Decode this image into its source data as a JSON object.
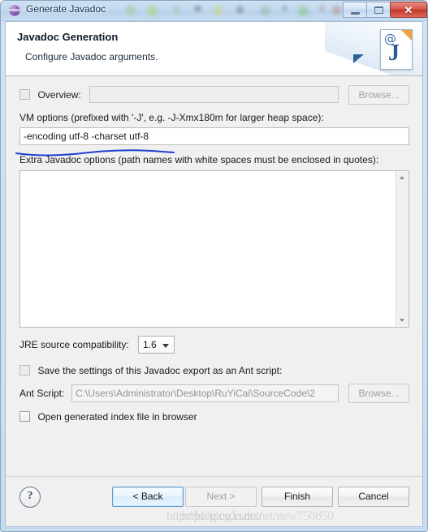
{
  "window": {
    "title": "Generate Javadoc",
    "app_icon": "eclipse-globe-icon",
    "controls": {
      "minimize": "minimize-icon",
      "maximize": "maximize-icon",
      "close": "✕"
    }
  },
  "header": {
    "title": "Javadoc Generation",
    "subtitle": "Configure Javadoc arguments.",
    "banner_icon": "javadoc-document-icon",
    "banner_at": "@",
    "banner_letter": "J"
  },
  "form": {
    "overview": {
      "checkbox_label": "Overview:",
      "checked": false,
      "value": "",
      "browse_label": "Browse..."
    },
    "vm_options": {
      "label": "VM options (prefixed with '-J', e.g. -J-Xmx180m for larger heap space):",
      "value": "-encoding utf-8 -charset utf-8"
    },
    "extra_options": {
      "label": "Extra Javadoc options (path names with white spaces must be enclosed in quotes):",
      "value": ""
    },
    "jre_compatibility": {
      "label": "JRE source compatibility:",
      "value": "1.6"
    },
    "ant_script_save": {
      "checkbox_label": "Save the settings of this Javadoc export as an Ant script:",
      "checked": false
    },
    "ant_script": {
      "label": "Ant Script:",
      "value": "C:\\Users\\Administrator\\Desktop\\RuYiCai\\SourceCode\\2",
      "browse_label": "Browse..."
    },
    "open_index": {
      "checkbox_label": "Open generated index file in browser",
      "checked": false
    }
  },
  "buttons": {
    "help": "?",
    "back": "< Back",
    "next": "Next >",
    "finish": "Finish",
    "cancel": "Cancel"
  },
  "annotations": {
    "underline_color": "#1f3fd0",
    "watermark_line_1": "http://blog.csdn.net/",
    "watermark_line_2": "http://blog.csdn.net/new750850"
  }
}
